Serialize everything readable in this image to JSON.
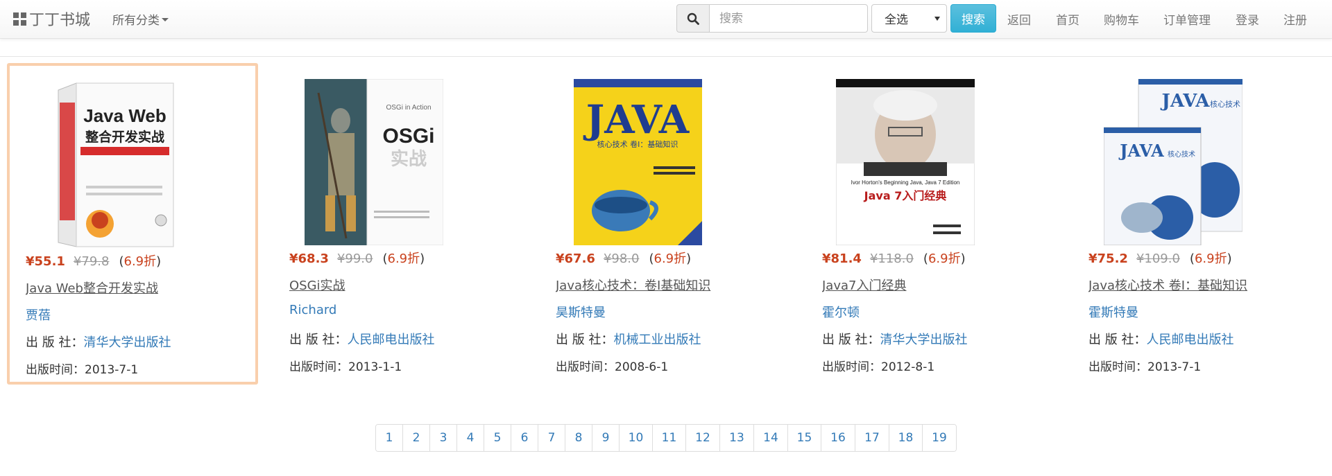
{
  "navbar": {
    "brand": "丁丁书城",
    "category_menu": "所有分类",
    "search_placeholder": "搜索",
    "select_value": "全选",
    "search_button": "搜索",
    "links": [
      "返回",
      "首页",
      "购物车",
      "订单管理",
      "登录",
      "注册"
    ]
  },
  "books": [
    {
      "price": "¥55.1",
      "old_price": "¥79.8",
      "discount": "6.9折",
      "title": "Java Web整合开发实战",
      "author": "贾蓓",
      "publisher_label": "出 版 社：",
      "publisher": "清华大学出版社",
      "pubdate_label": "出版时间：",
      "pubdate": "2013-7-1",
      "cover_lines": [
        "Java Web",
        "整合开发实战"
      ],
      "cover_color": "#d62c2c"
    },
    {
      "price": "¥68.3",
      "old_price": "¥99.0",
      "discount": "6.9折",
      "title": "OSGi实战",
      "author": "Richard",
      "publisher_label": "出 版 社：",
      "publisher": "人民邮电出版社",
      "pubdate_label": "出版时间：",
      "pubdate": "2013-1-1",
      "cover_lines": [
        "OSGi in Action",
        "OSGi",
        "实战"
      ],
      "cover_color": "#3a5a63"
    },
    {
      "price": "¥67.6",
      "old_price": "¥98.0",
      "discount": "6.9折",
      "title": "Java核心技术：卷Ⅰ基础知识",
      "author": "昊斯特曼",
      "publisher_label": "出 版 社：",
      "publisher": "机械工业出版社",
      "pubdate_label": "出版时间：",
      "pubdate": "2008-6-1",
      "cover_lines": [
        "JAVA",
        "核心技术 卷Ⅰ：基础知识"
      ],
      "cover_color": "#f5d21a"
    },
    {
      "price": "¥81.4",
      "old_price": "¥118.0",
      "discount": "6.9折",
      "title": "Java7入门经典",
      "author": "霍尔顿",
      "publisher_label": "出 版 社：",
      "publisher": "清华大学出版社",
      "pubdate_label": "出版时间：",
      "pubdate": "2012-8-1",
      "cover_lines": [
        "Ivor Horton's Beginning Java, Java 7 Edition",
        "Java 7入门经典"
      ],
      "cover_color": "#111111"
    },
    {
      "price": "¥75.2",
      "old_price": "¥109.0",
      "discount": "6.9折",
      "title": "Java核心技术 卷I：基础知识",
      "author": "霍斯特曼",
      "publisher_label": "出 版 社：",
      "publisher": "人民邮电出版社",
      "pubdate_label": "出版时间：",
      "pubdate": "2013-7-1",
      "cover_lines": [
        "JAVA",
        "核心技术"
      ],
      "cover_color": "#2b5ea7"
    }
  ],
  "pagination": [
    "1",
    "2",
    "3",
    "4",
    "5",
    "6",
    "7",
    "8",
    "9",
    "10",
    "11",
    "12",
    "13",
    "14",
    "15",
    "16",
    "17",
    "18",
    "19"
  ],
  "colors": {
    "price": "#c9421e",
    "link": "#337ab7",
    "selected_border": "#f9cfac",
    "search_button": "#5bc0de"
  }
}
